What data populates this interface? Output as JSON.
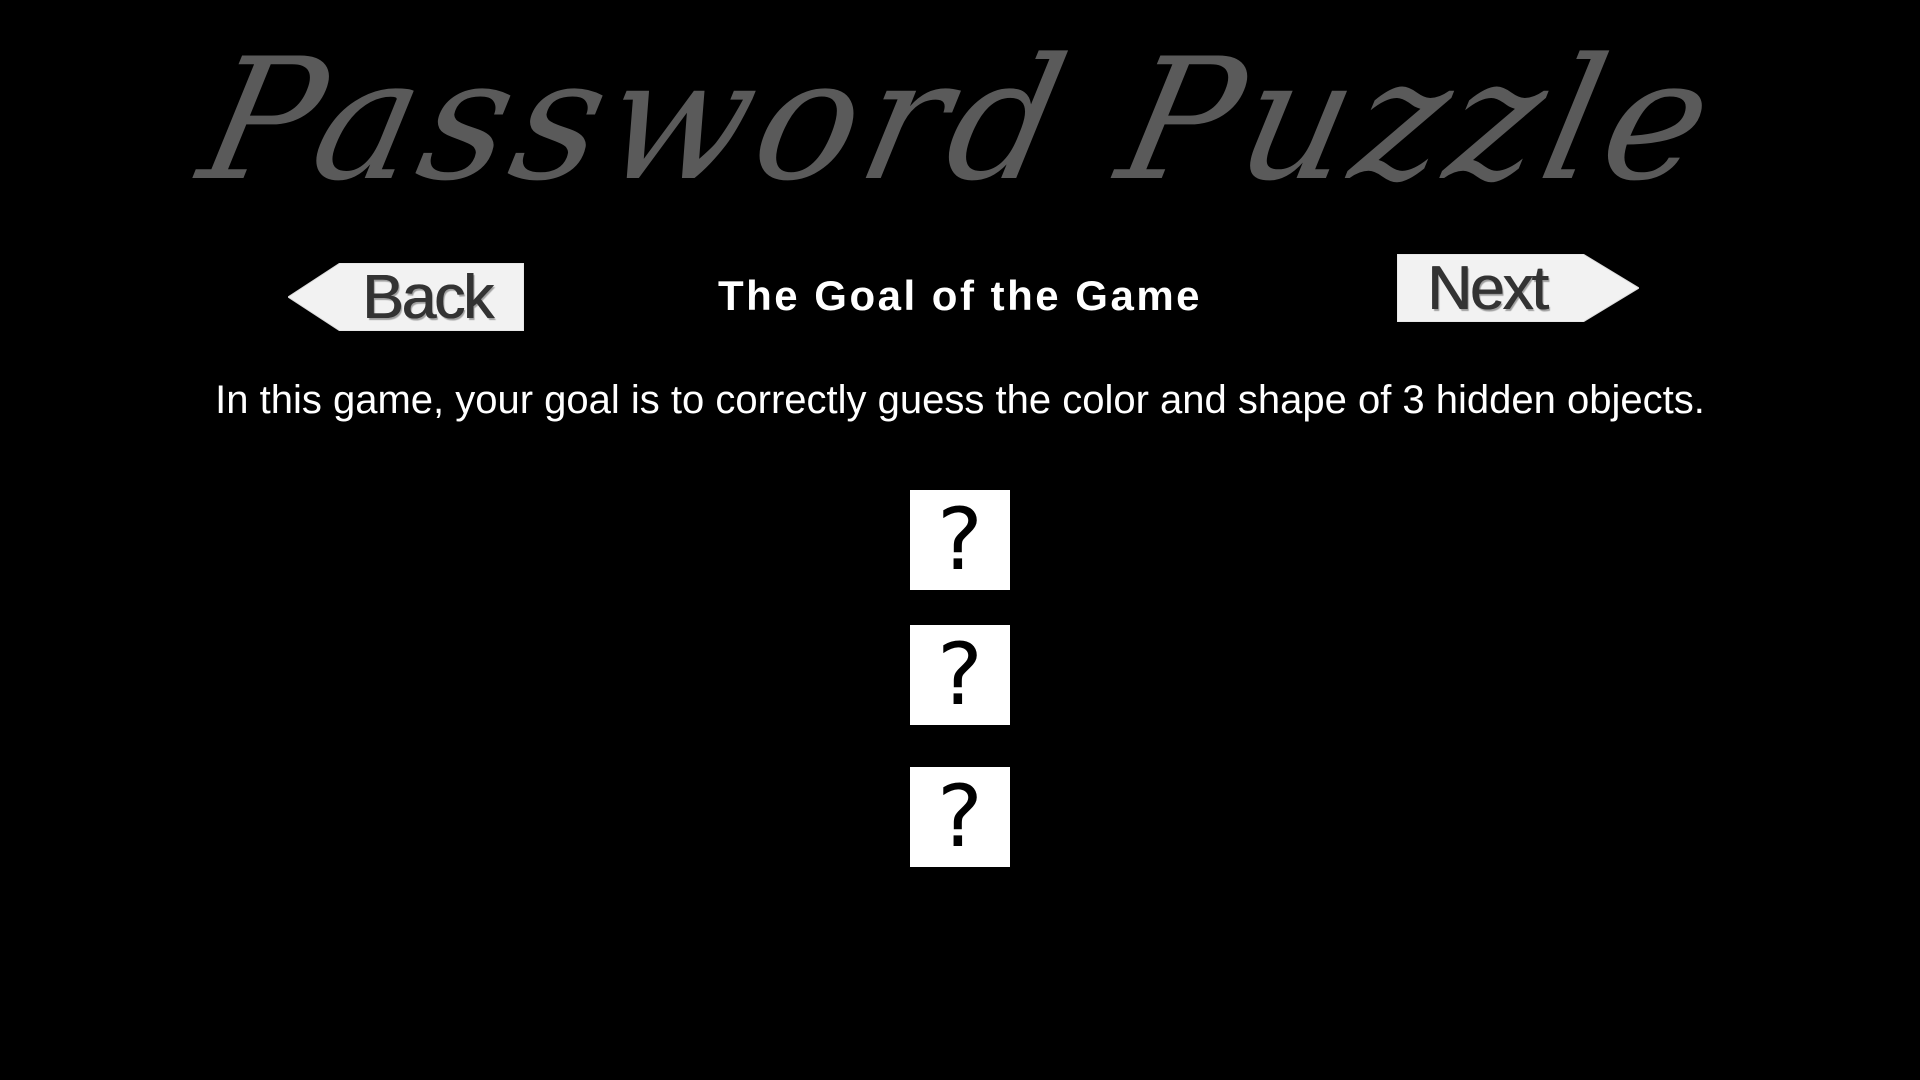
{
  "title": "Password Puzzle",
  "nav": {
    "back_label": "Back",
    "next_label": "Next"
  },
  "heading": "The Goal of the Game",
  "description": "In this game, your goal is to correctly guess the color and shape of 3 hidden objects.",
  "hidden_objects": [
    {
      "symbol": "?"
    },
    {
      "symbol": "?"
    },
    {
      "symbol": "?"
    }
  ],
  "colors": {
    "background": "#000000",
    "title": "#5a5a5a",
    "button_fill": "#f2f2f2",
    "button_text": "#333333",
    "text": "#ffffff",
    "box_fill": "#ffffff"
  },
  "icons": {
    "back": "left-arrow-icon",
    "next": "right-arrow-icon",
    "hidden_object": "question-mark-icon"
  }
}
